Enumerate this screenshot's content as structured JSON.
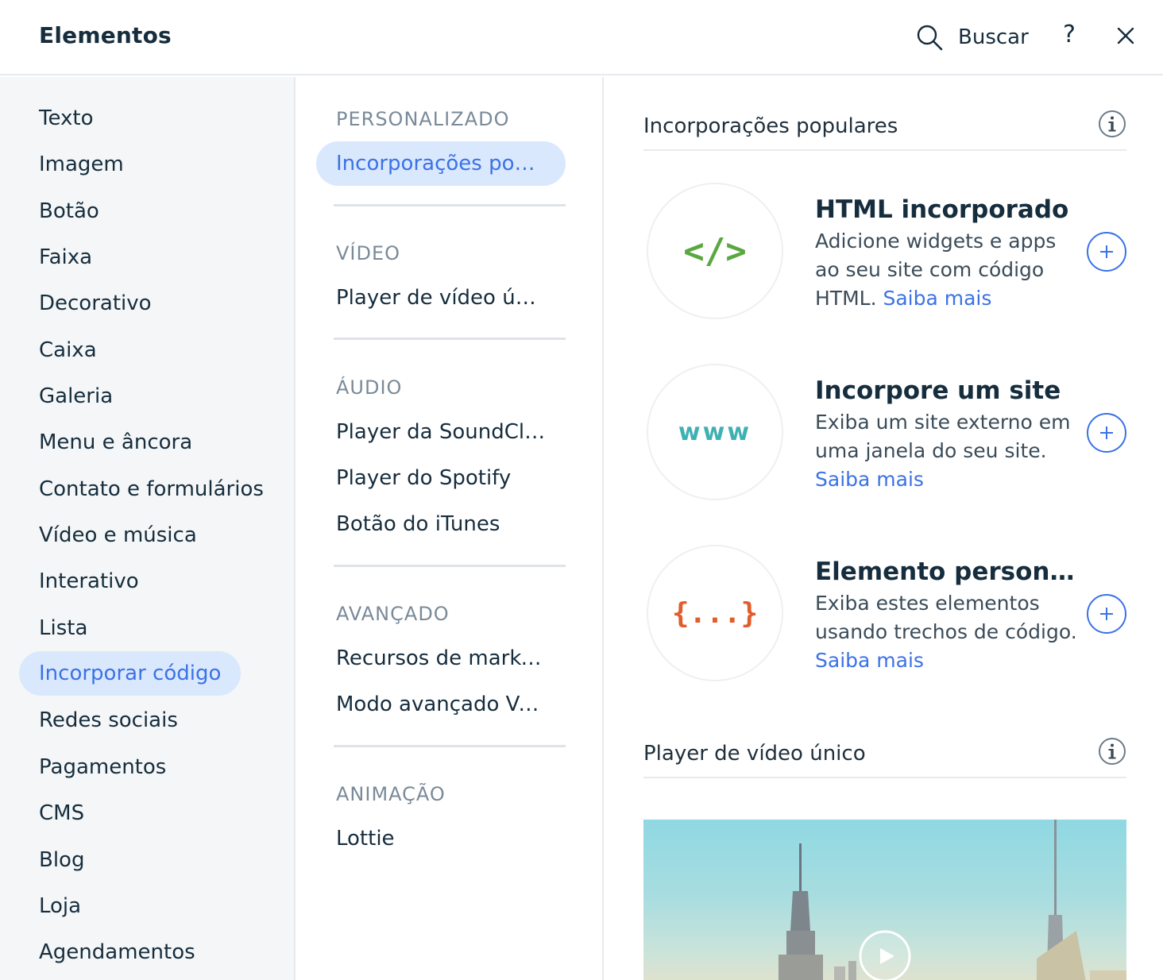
{
  "header": {
    "title": "Elementos",
    "search_label": "Buscar",
    "help_label": "?"
  },
  "categories": [
    {
      "label": "Texto",
      "active": false
    },
    {
      "label": "Imagem",
      "active": false
    },
    {
      "label": "Botão",
      "active": false
    },
    {
      "label": "Faixa",
      "active": false
    },
    {
      "label": "Decorativo",
      "active": false
    },
    {
      "label": "Caixa",
      "active": false
    },
    {
      "label": "Galeria",
      "active": false
    },
    {
      "label": "Menu e âncora",
      "active": false
    },
    {
      "label": "Contato e formulários",
      "active": false
    },
    {
      "label": "Vídeo e música",
      "active": false
    },
    {
      "label": "Interativo",
      "active": false
    },
    {
      "label": "Lista",
      "active": false
    },
    {
      "label": "Incorporar código",
      "active": true
    },
    {
      "label": "Redes sociais",
      "active": false
    },
    {
      "label": "Pagamentos",
      "active": false
    },
    {
      "label": "CMS",
      "active": false
    },
    {
      "label": "Blog",
      "active": false
    },
    {
      "label": "Loja",
      "active": false
    },
    {
      "label": "Agendamentos",
      "active": false
    }
  ],
  "subcategories": {
    "personalizado": {
      "heading": "PERSONALIZADO",
      "items": [
        "Incorporações populares"
      ]
    },
    "video": {
      "heading": "VÍDEO",
      "items": [
        "Player de vídeo único"
      ]
    },
    "audio": {
      "heading": "ÁUDIO",
      "items": [
        "Player da SoundCloud",
        "Player do Spotify",
        "Botão do iTunes"
      ]
    },
    "avancado": {
      "heading": "AVANÇADO",
      "items": [
        "Recursos de marketing",
        "Modo avançado Velo"
      ]
    },
    "animacao": {
      "heading": "ANIMAÇÃO",
      "items": [
        "Lottie"
      ]
    }
  },
  "content": {
    "popular": {
      "heading": "Incorporações populares",
      "cards": [
        {
          "title": "HTML incorporado",
          "desc": "Adicione widgets e apps ao seu site com código HTML.",
          "link": "Saiba mais",
          "icon": "code-icon",
          "icon_text": "</>",
          "icon_color": "#5aa83f"
        },
        {
          "title": "Incorpore um site",
          "desc": "Exiba um site externo em uma janela do seu site.",
          "link": "Saiba mais",
          "icon": "www-icon",
          "icon_text": "www",
          "icon_color": "#3fb1b3"
        },
        {
          "title": "Elemento personalizado",
          "desc": "Exiba estes elementos usando trechos de código.",
          "link": "Saiba mais",
          "icon": "braces-icon",
          "icon_text": "{...}",
          "icon_color": "#e25d2c"
        }
      ]
    },
    "video": {
      "heading": "Player de vídeo único"
    }
  },
  "colors": {
    "accent": "#3b72e6",
    "active_bg": "#dae8fd",
    "sidebar_bg": "#f4f6f7"
  }
}
